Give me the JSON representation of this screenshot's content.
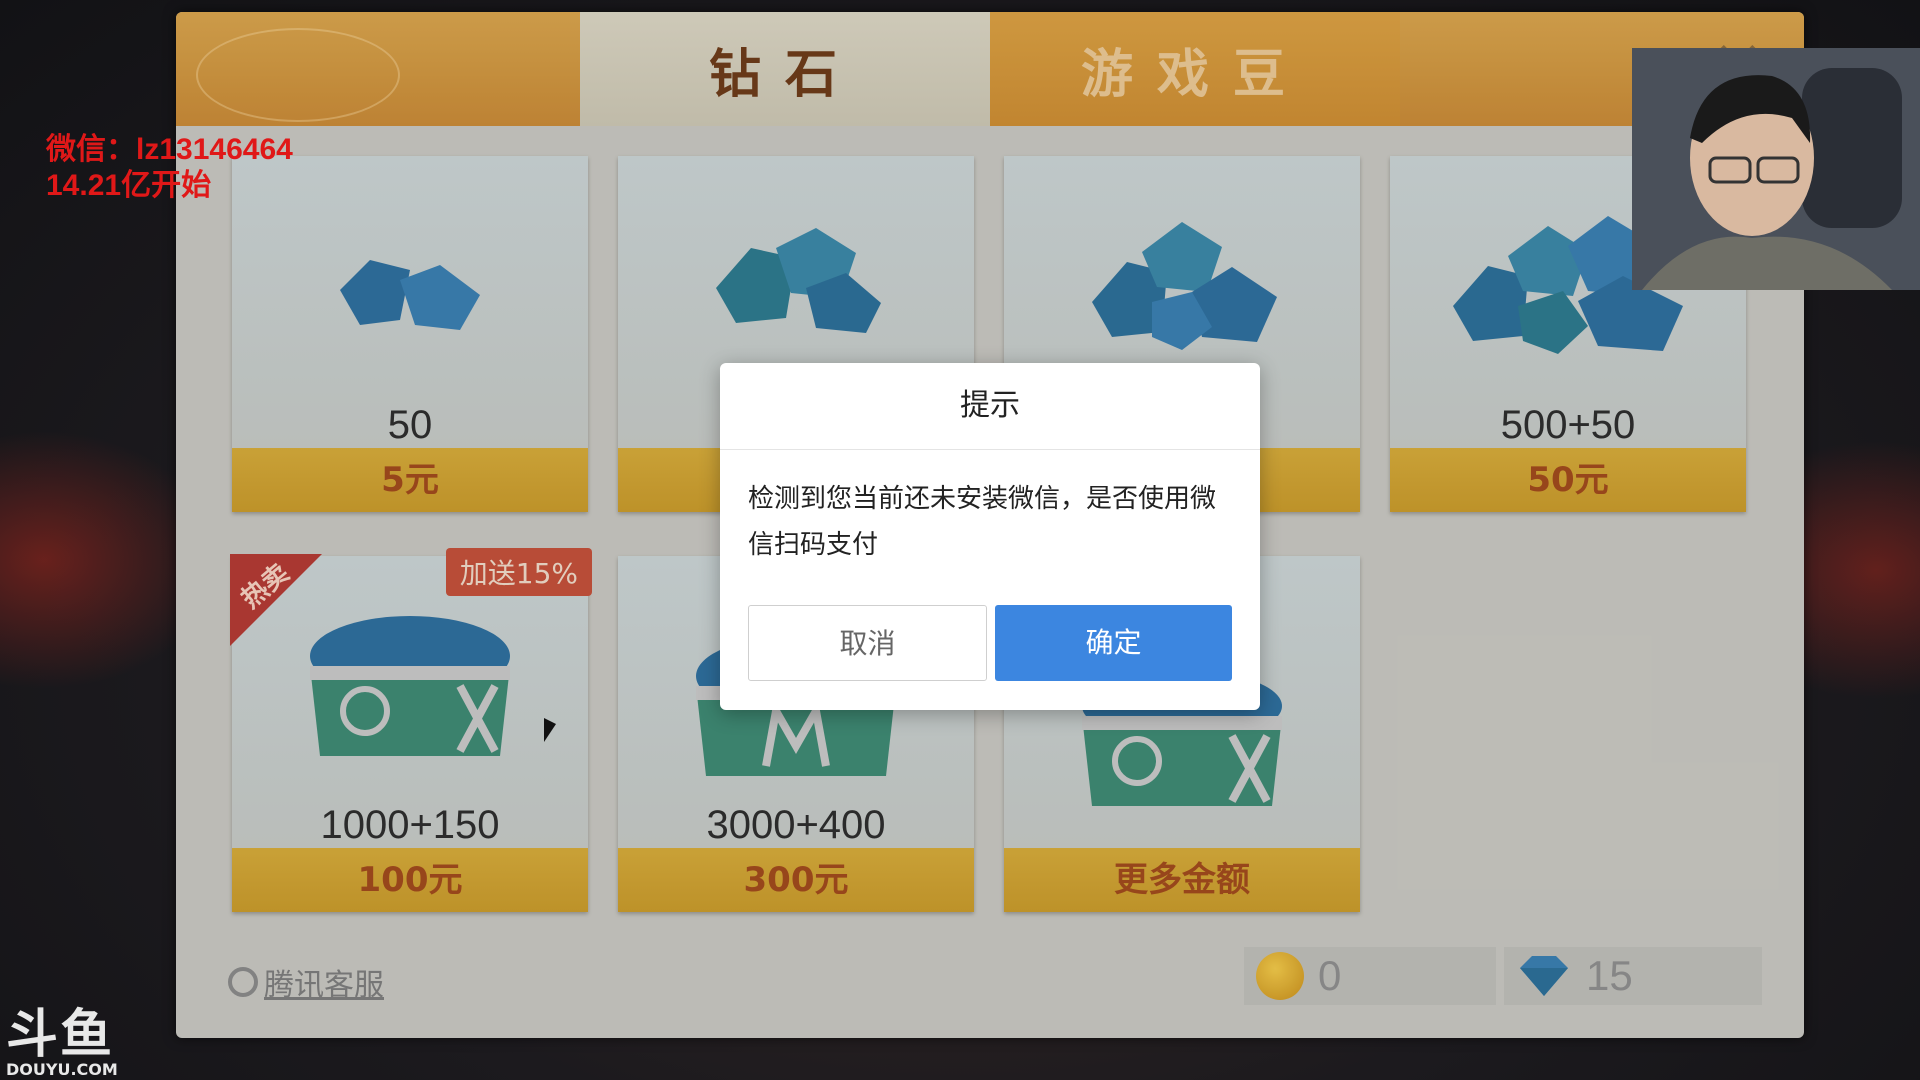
{
  "tabs": [
    {
      "label": "钻石",
      "active": true
    },
    {
      "label": "游戏豆",
      "active": false
    }
  ],
  "packages": [
    {
      "amount": "50",
      "price": "5元"
    },
    {
      "amount": "",
      "price": ""
    },
    {
      "amount": "",
      "price": ""
    },
    {
      "amount": "500+50",
      "price": "50元"
    },
    {
      "amount": "1000+150",
      "price": "100元",
      "hot_label": "热卖",
      "bonus_label": "加送15%"
    },
    {
      "amount": "3000+400",
      "price": "300元"
    },
    {
      "amount": "",
      "price": "更多金额"
    }
  ],
  "footer": {
    "service_label": "腾讯客服",
    "bean_balance": "0",
    "diamond_balance": "15"
  },
  "dialog": {
    "title": "提示",
    "message": "检测到您当前还未安装微信，是否使用微信扫码支付",
    "cancel_label": "取消",
    "confirm_label": "确定"
  },
  "overlay_text": {
    "wechat": "微信：lz13146464",
    "start": "14.21亿开始"
  },
  "watermark": {
    "logo_text": "斗鱼",
    "logo_sub": "DOUYU.COM"
  },
  "colors": {
    "confirm_button": "#3c86e0",
    "price_bar": "#d4aa3a",
    "price_text": "#a04a1d",
    "overlay_red": "#e01818"
  },
  "icons": [
    "diamond-icon",
    "treasure-chest-icon",
    "coin-icon",
    "close-icon",
    "qq-service-icon"
  ]
}
